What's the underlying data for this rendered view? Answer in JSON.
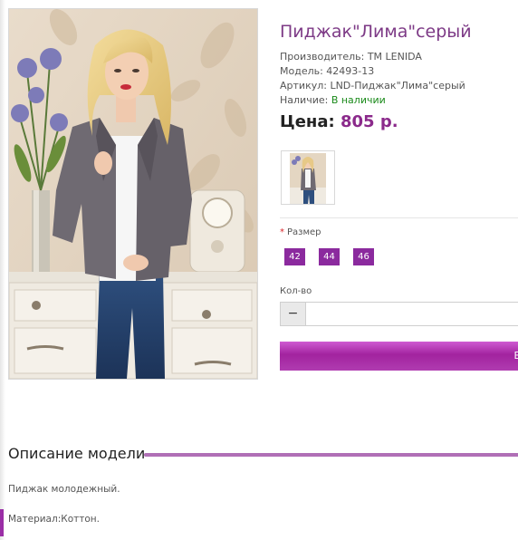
{
  "product": {
    "title": "Пиджак\"Лима\"серый",
    "manufacturer": "Производитель: ТМ LENIDA",
    "model": "Модель: 42493-13",
    "article": "Артикул: LND-Пиджак\"Лима\"серый",
    "availability_label": "Наличие: ",
    "availability_value": "В наличии",
    "price_label": "Цена:",
    "price_value": "805 р."
  },
  "options": {
    "size_label": "Размер",
    "required_mark": "*",
    "sizes": [
      "42",
      "44",
      "46"
    ]
  },
  "quantity": {
    "label": "Кол-во",
    "minus_label": "−",
    "value": ""
  },
  "buy_button": {
    "label": "В"
  },
  "description": {
    "heading": "Описание модели",
    "text1": "Пиджак молодежный.",
    "text2": "Материал:Коттон."
  },
  "colors": {
    "accent_purple": "#7d3a86",
    "size_button": "#8b2a9e",
    "in_stock": "#1a8a1a",
    "buy_button": "#a2239f",
    "required": "#d9262b"
  }
}
